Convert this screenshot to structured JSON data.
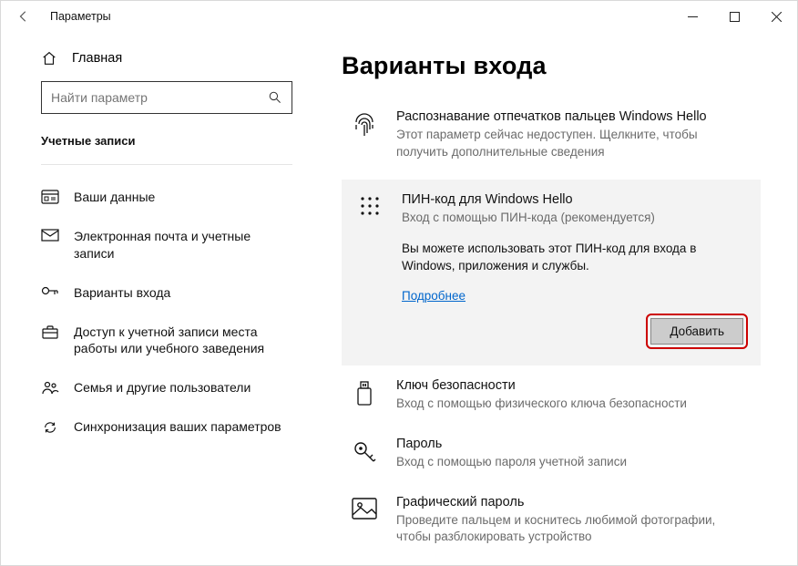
{
  "window": {
    "title": "Параметры"
  },
  "sidebar": {
    "home": "Главная",
    "search_placeholder": "Найти параметр",
    "category": "Учетные записи",
    "items": [
      {
        "label": "Ваши данные"
      },
      {
        "label": "Электронная почта и учетные записи"
      },
      {
        "label": "Варианты входа"
      },
      {
        "label": "Доступ к учетной записи места работы или учебного заведения"
      },
      {
        "label": "Семья и другие пользователи"
      },
      {
        "label": "Синхронизация ваших параметров"
      }
    ]
  },
  "main": {
    "heading": "Варианты входа",
    "options": [
      {
        "title": "Распознавание отпечатков пальцев Windows Hello",
        "desc": "Этот параметр сейчас недоступен. Щелкните, чтобы получить дополнительные сведения"
      },
      {
        "title": "ПИН-код для Windows Hello",
        "desc": "Вход с помощью ПИН-кода (рекомендуется)",
        "body": "Вы можете использовать этот ПИН-код для входа в Windows, приложения и службы.",
        "link": "Подробнее",
        "button": "Добавить"
      },
      {
        "title": "Ключ безопасности",
        "desc": "Вход с помощью физического ключа безопасности"
      },
      {
        "title": "Пароль",
        "desc": "Вход с помощью пароля учетной записи"
      },
      {
        "title": "Графический пароль",
        "desc": "Проведите пальцем и коснитесь любимой фотографии, чтобы разблокировать устройство"
      }
    ]
  }
}
